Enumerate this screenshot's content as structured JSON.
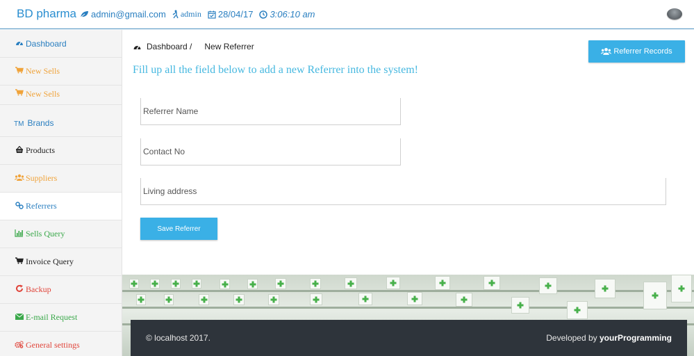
{
  "header": {
    "brand": "BD pharma",
    "email": "admin@gmail.com",
    "user": "admin",
    "date": "28/04/17",
    "time": "3:06:10 am"
  },
  "sidebar": {
    "items": [
      {
        "label": "Dashboard",
        "icon": "dashboard-icon"
      },
      {
        "label": "New Sells",
        "icon": "cart-icon"
      },
      {
        "label": "New Sells",
        "icon": "cart-icon"
      },
      {
        "label": "Brands",
        "icon": "trademark-icon",
        "prefix": "TM"
      },
      {
        "label": "Products",
        "icon": "basket-icon"
      },
      {
        "label": "Suppliers",
        "icon": "users-icon"
      },
      {
        "label": "Referrers",
        "icon": "link-icon"
      },
      {
        "label": "Sells Query",
        "icon": "bar-chart-icon"
      },
      {
        "label": "Invoice Query",
        "icon": "cart-icon"
      },
      {
        "label": "Backup",
        "icon": "refresh-icon"
      },
      {
        "label": "E-mail Request",
        "icon": "envelope-icon"
      },
      {
        "label": "General settings",
        "icon": "gears-icon"
      }
    ]
  },
  "breadcrumb": {
    "home": "Dashboard /",
    "current": "New Referrer"
  },
  "actions": {
    "records_label": "Referrer Records",
    "save_label": "Save Referrer"
  },
  "form": {
    "headline": "Fill up all the field below to add a new Referrer into the system!",
    "name_placeholder": "Referrer Name",
    "contact_placeholder": "Contact No",
    "address_placeholder": "Living address"
  },
  "footer": {
    "copyright": "© localhost 2017.",
    "developed_prefix": "Developed by ",
    "developer": "yourProgramming"
  },
  "colors": {
    "accent": "#3ab0e6",
    "brand": "#2a8ed0",
    "orange": "#f0a33a",
    "green": "#3aa84a",
    "red": "#e0443a",
    "footer": "#2e343b"
  }
}
